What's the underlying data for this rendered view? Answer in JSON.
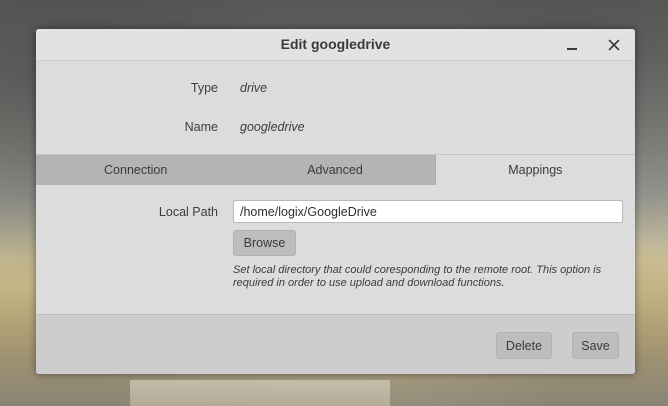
{
  "window": {
    "title": "Edit googledrive",
    "minimize_icon": "minimize-icon",
    "close_icon": "close-icon"
  },
  "info": {
    "type_label": "Type",
    "type_value": "drive",
    "name_label": "Name",
    "name_value": "googledrive"
  },
  "tabs": [
    {
      "label": "Connection",
      "active": false
    },
    {
      "label": "Advanced",
      "active": false
    },
    {
      "label": "Mappings",
      "active": true
    }
  ],
  "mappings": {
    "local_path_label": "Local Path",
    "local_path_value": "/home/logix/GoogleDrive",
    "browse_label": "Browse",
    "help_text": "Set local directory that could coresponding to the remote root. This option is required in order to use upload and download functions."
  },
  "footer": {
    "delete_label": "Delete",
    "save_label": "Save"
  }
}
